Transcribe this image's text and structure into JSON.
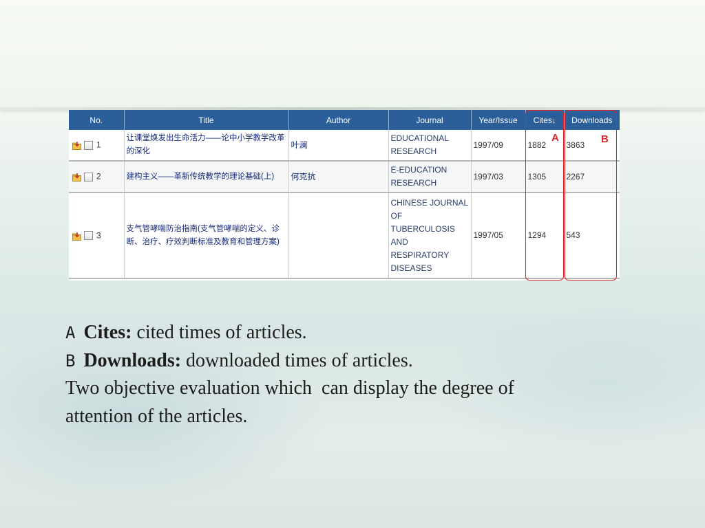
{
  "table": {
    "headers": [
      "No.",
      "Title",
      "Author",
      "Journal",
      "Year/Issue",
      "Cites",
      "Downloads"
    ],
    "sort_arrow": "↓",
    "rows": [
      {
        "no": "1",
        "title": "让课堂焕发出生命活力——论中小学教学改革的深化",
        "author": "叶澜",
        "journal": "EDUCATIONAL RESEARCH",
        "year_issue": "1997/09",
        "cites": "1882",
        "downloads": "3863"
      },
      {
        "no": "2",
        "title": "建构主义——革新传统教学的理论基础(上)",
        "author": "何克抗",
        "journal": "E-EDUCATION RESEARCH",
        "year_issue": "1997/03",
        "cites": "1305",
        "downloads": "2267"
      },
      {
        "no": "3",
        "title": "支气管哮喘防治指南(支气管哮喘的定义、诊断、治疗、疗效判断标准及教育和管理方案)",
        "author": "",
        "journal": "CHINESE JOURNAL OF TUBERCULOSIS AND RESPIRATORY DISEASES",
        "year_issue": "1997/05",
        "cites": "1294",
        "downloads": "543"
      }
    ]
  },
  "markers": {
    "a": "A",
    "b": "B"
  },
  "caption": {
    "line1": {
      "letter": "A",
      "term": "Cites:",
      "text": " cited times of articles."
    },
    "line2": {
      "letter": "B",
      "term": "Downloads:",
      "text": " downloaded times of articles."
    },
    "line3": "Two objective evaluation which  can display the degree of",
    "line4": "attention of the articles."
  },
  "colors": {
    "header_bg": "#2a5f9a",
    "highlight": "#d9262c",
    "link_text": "#15287a"
  },
  "icons": [
    "save-to-folder-icon",
    "checkbox"
  ]
}
